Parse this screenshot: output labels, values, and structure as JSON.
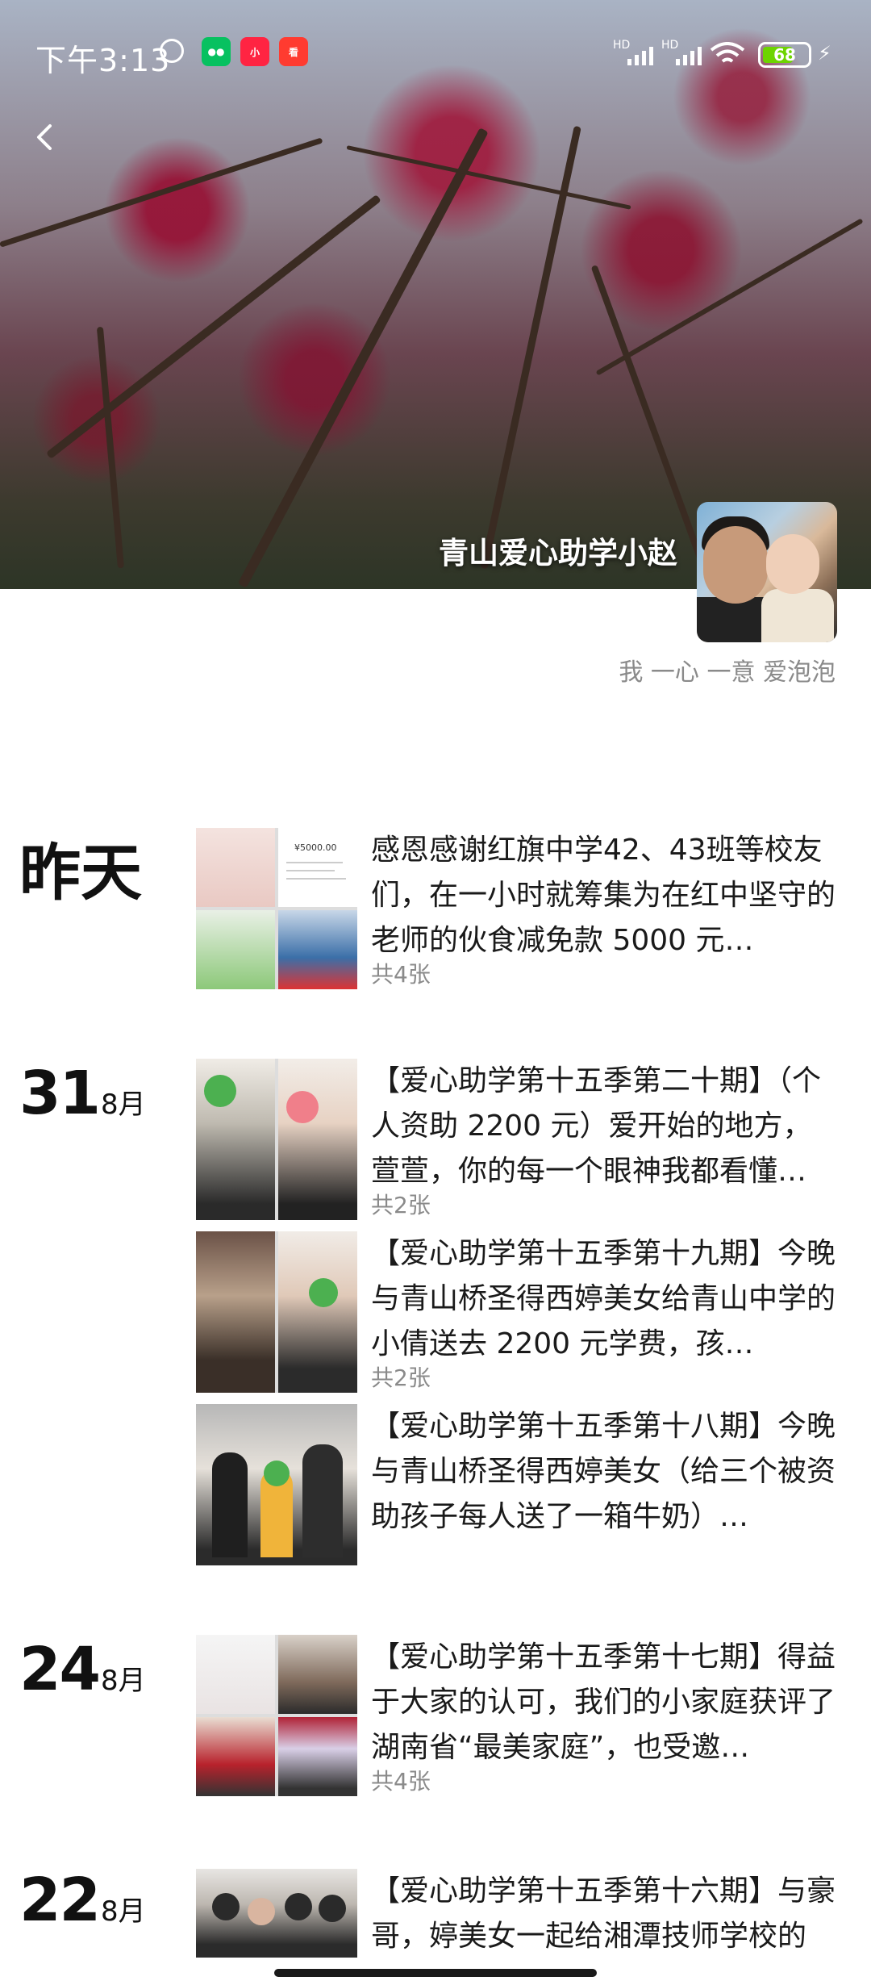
{
  "status_bar": {
    "time": "下午3:13",
    "network_label_1": "HD",
    "network_label_2": "HD",
    "battery_level": "68",
    "battery_fraction": 0.68
  },
  "profile": {
    "name": "青山爱心助学小赵",
    "signature": "我 一心 一意 爱泡泡"
  },
  "posts": [
    {
      "date_label": "昨天",
      "text": "感恩感谢红旗中学42、43班等校友们，在一小时就筹集为在红中坚守的老师的伙食减免款 5000 元…",
      "image_count": "共4张",
      "thumb_note": "¥5000.00"
    },
    {
      "day": "31",
      "month": "8月",
      "text": "【爱心助学第十五季第二十期】（个人资助 2200 元）爱开始的地方，萱萱，你的每一个眼神我都看懂…",
      "image_count": "共2张"
    },
    {
      "text": "【爱心助学第十五季第十九期】今晚与青山桥圣得西婷美女给青山中学的小倩送去 2200 元学费，孩…",
      "image_count": "共2张"
    },
    {
      "text": "【爱心助学第十五季第十八期】今晚与青山桥圣得西婷美女（给三个被资助孩子每人送了一箱牛奶）…",
      "image_count": ""
    },
    {
      "day": "24",
      "month": "8月",
      "text": "【爱心助学第十五季第十七期】得益于大家的认可，我们的小家庭获评了湖南省“最美家庭”，也受邀…",
      "image_count": "共4张"
    },
    {
      "day": "22",
      "month": "8月",
      "text": "【爱心助学第十五季第十六期】与豪哥，婷美女一起给湘潭技师学校的",
      "image_count": ""
    }
  ]
}
